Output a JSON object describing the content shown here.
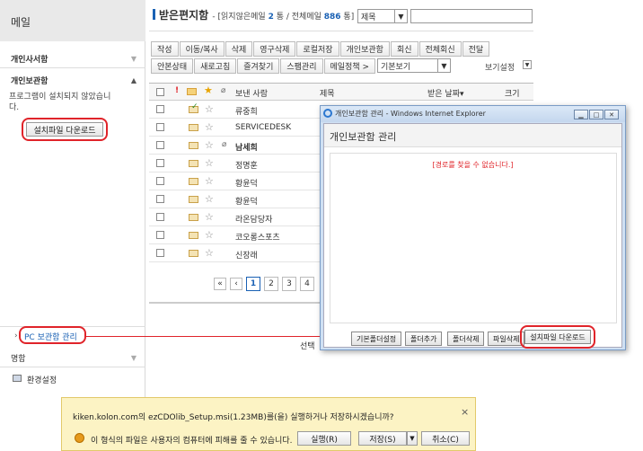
{
  "sidebar": {
    "title": "메일",
    "section1": "개인사서함",
    "section2": "개인보관함",
    "note": "프로그램이 설치되지 않았습니다.",
    "install_button": "설치파일 다운로드",
    "pc_archive_link": "PC 보관함 관리",
    "section3": "명함",
    "settings": "환경설정"
  },
  "main": {
    "title": "받은편지함",
    "stat_prefix": "- [읽지않은메일",
    "unread": "2",
    "stat_mid": "통 / 전체메일",
    "total": "886",
    "stat_suffix": "통]",
    "search_field": "제목",
    "toolbar_row1": [
      "작성",
      "이동/복사",
      "삭제",
      "영구삭제",
      "로컬저장",
      "개인보관함",
      "회신",
      "전체회신",
      "전달"
    ],
    "toolbar_row2": [
      "안본상태",
      "새로고침",
      "즐겨찾기",
      "스팸관리",
      "메일정책 >"
    ],
    "view_select": "기본보기",
    "view_settings": "보기설정",
    "columns": {
      "sender": "보낸 사람",
      "subject": "제목",
      "date": "받은 날짜",
      "size": "크기"
    },
    "rows": [
      "류중희",
      "SERVICEDESK",
      "남세희",
      "정명훈",
      "황윤덕",
      "황윤덕",
      "라온담당자",
      "코오롱스포츠",
      "신장래"
    ],
    "pages": [
      "1",
      "2",
      "3",
      "4"
    ],
    "select_label": "선택"
  },
  "popup": {
    "window_title": "개인보관함 관리 - Windows Internet Explorer",
    "heading": "개인보관함 관리",
    "error": "[경로를 찾을 수 없습니다.]",
    "buttons": [
      "기본폴더설정",
      "폴더추가",
      "폴더삭제",
      "파일삭제"
    ],
    "install_button": "설치파일 다운로드"
  },
  "download_bar": {
    "message": "kiken.kolon.com의 ezCDOlib_Setup.msi(1.23MB)를(을) 실행하거나 저장하시겠습니까?",
    "warning": "이 형식의 파일은 사용자의 컴퓨터에 피해를 줄 수 있습니다.",
    "run": "실행(R)",
    "save": "저장(S)",
    "cancel": "취소(C)",
    "close": "×"
  },
  "colors": {
    "accent": "#1a61b4",
    "highlight": "#e0242a",
    "error": "#e0242a"
  }
}
